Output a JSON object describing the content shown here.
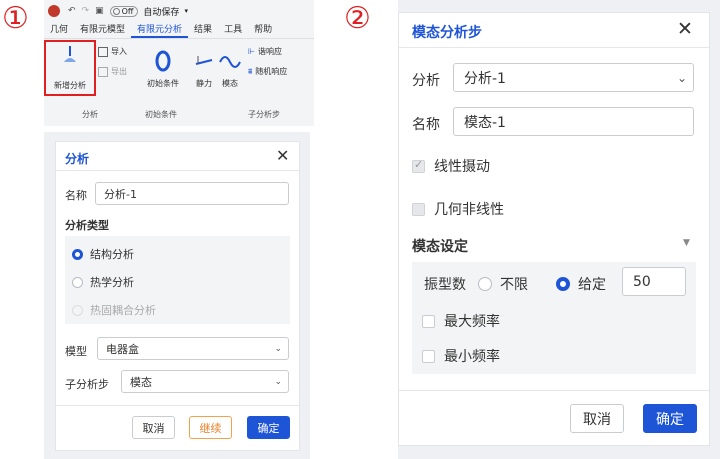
{
  "steps": {
    "one": "①",
    "two": "②"
  },
  "ribbon": {
    "quick_access": {
      "toggle_state": "Off",
      "autosave_label": "自动保存"
    },
    "tabs": [
      "几何",
      "有限元模型",
      "有限元分析",
      "结果",
      "工具",
      "帮助"
    ],
    "active_tab": "有限元分析",
    "buttons": {
      "new_analysis": "新增分析",
      "import": "导入",
      "export": "导出",
      "initial_conditions": "初始条件",
      "statics": "静力",
      "modal": "模态",
      "harmonic_response": "谐响应",
      "random_response": "随机响应"
    },
    "groups": {
      "analysis": "分析",
      "initial_conditions": "初始条件",
      "sub_analysis": "子分析步"
    }
  },
  "analysis_dialog": {
    "title": "分析",
    "name_label": "名称",
    "name_value": "分析-1",
    "type_heading": "分析类型",
    "types": [
      "结构分析",
      "热学分析",
      "热固耦合分析"
    ],
    "selected_type": "结构分析",
    "model_label": "模型",
    "model_value": "电器盒",
    "substep_label": "子分析步",
    "substep_value": "模态",
    "cancel": "取消",
    "continue": "继续",
    "confirm": "确定"
  },
  "modal_dialog": {
    "title": "模态分析步",
    "analysis_label": "分析",
    "analysis_value": "分析-1",
    "name_label": "名称",
    "name_value": "模态-1",
    "linear_perturbation": "线性摄动",
    "geometric_nonlinearity": "几何非线性",
    "settings_heading": "模态设定",
    "mode_count_label": "振型数",
    "unlimited": "不限",
    "given": "给定",
    "mode_count_value": "50",
    "max_freq": "最大频率",
    "min_freq": "最小频率",
    "cancel": "取消",
    "confirm": "确定"
  },
  "colors": {
    "accent": "#1e54d6",
    "highlight": "#e02020",
    "continue": "#e8812b"
  }
}
